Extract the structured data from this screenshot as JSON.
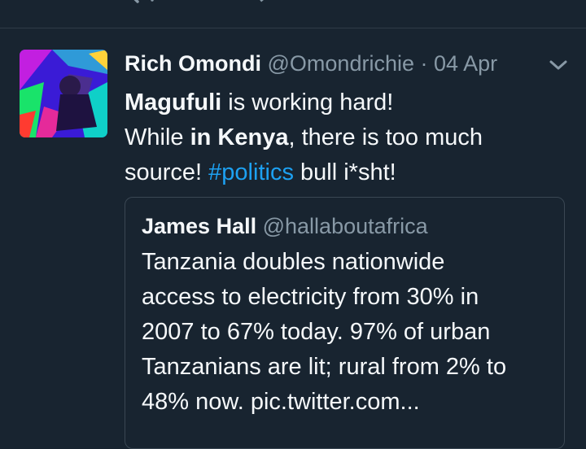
{
  "tweet": {
    "display_name": "Rich Omondi",
    "handle": "@Omondrichie",
    "separator": "·",
    "date": "04 Apr",
    "text": {
      "part1_bold": "Magufuli",
      "part2": " is working hard!",
      "part3": "While ",
      "part4_bold": "in Kenya",
      "part5": ", there is too much",
      "part6": "source! ",
      "hashtag": "#politics",
      "part7": " bull i*sht!"
    }
  },
  "quoted_tweet": {
    "display_name": "James Hall",
    "handle": "@hallaboutafrica",
    "lines": [
      "Tanzania doubles nationwide",
      "access to electricity from 30% in",
      "2007 to 67% today. 97% of urban",
      "Tanzanians are lit; rural from 2% to",
      "48% now. pic.twitter.com..."
    ]
  },
  "icons": {
    "reply": "reply-icon",
    "retweet": "retweet-icon",
    "like": "heart-icon",
    "dm": "message-icon",
    "menu": "chevron-down-icon"
  },
  "colors": {
    "background": "#182430",
    "link": "#1da1f2",
    "muted": "#8899a6"
  }
}
